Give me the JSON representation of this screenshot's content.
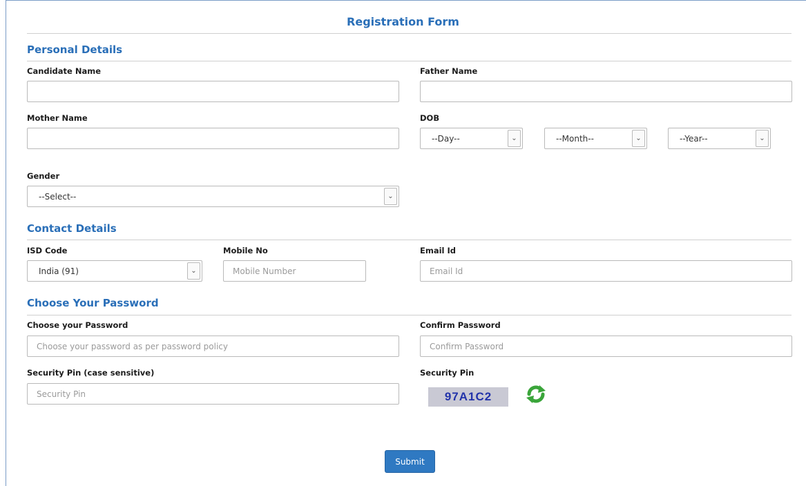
{
  "form": {
    "title": "Registration Form",
    "submit_label": "Submit"
  },
  "personal": {
    "heading": "Personal Details",
    "candidate_label": "Candidate Name",
    "father_label": "Father Name",
    "mother_label": "Mother Name",
    "dob_label": "DOB",
    "dob_day": "--Day--",
    "dob_month": "--Month--",
    "dob_year": "--Year--",
    "gender_label": "Gender",
    "gender_value": "--Select--"
  },
  "contact": {
    "heading": "Contact Details",
    "isd_label": "ISD Code",
    "isd_value": "India (91)",
    "mobile_label": "Mobile No",
    "mobile_placeholder": "Mobile Number",
    "email_label": "Email Id",
    "email_placeholder": "Email Id"
  },
  "password": {
    "heading": "Choose Your Password",
    "choose_label": "Choose your Password",
    "choose_placeholder": "Choose your password as per password policy",
    "confirm_label": "Confirm Password",
    "confirm_placeholder": "Confirm Password",
    "pin_label": "Security Pin (case sensitive)",
    "pin_placeholder": "Security Pin",
    "captcha_label": "Security Pin",
    "captcha_text": "97A1C2",
    "refresh_icon": "refresh-icon",
    "refresh_color": "#3aa53a"
  },
  "colors": {
    "accent": "#2a6fb8",
    "button": "#2f79c2"
  }
}
